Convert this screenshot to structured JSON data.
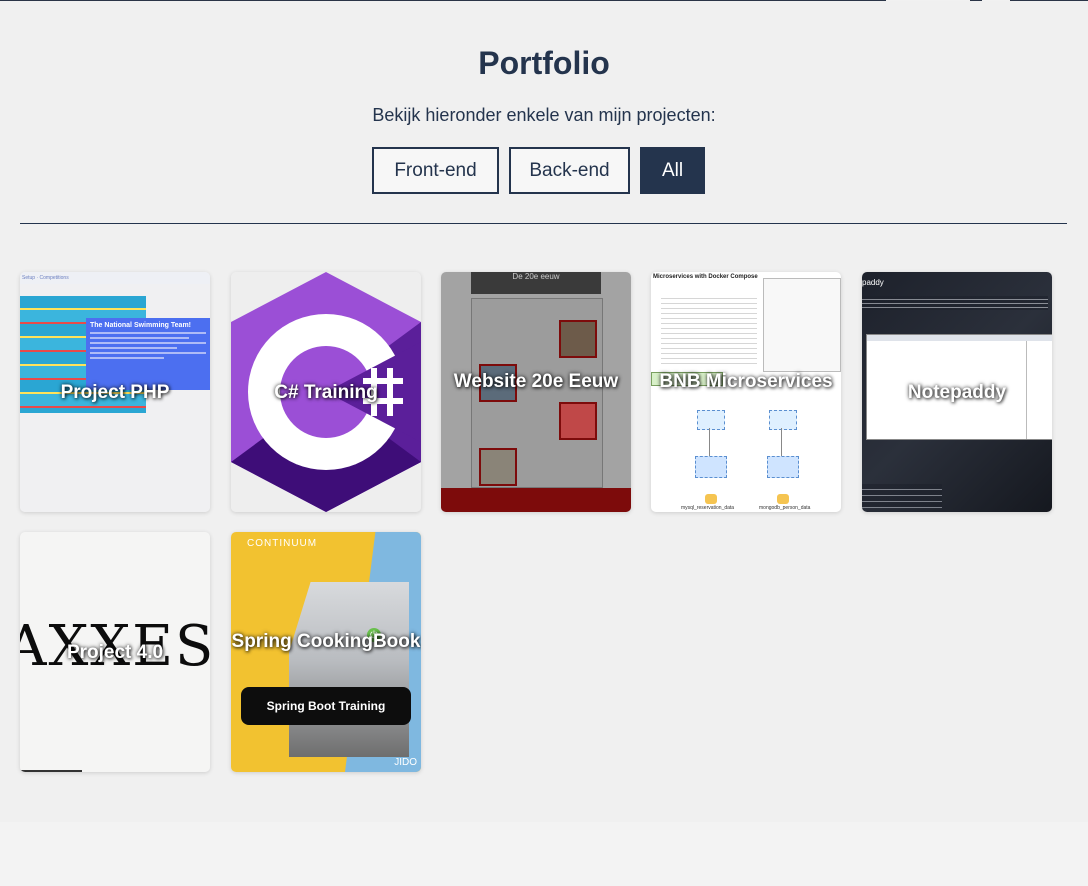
{
  "portfolio": {
    "title": "Portfolio",
    "subtitle": "Bekijk hieronder enkele van mijn projecten:",
    "filters": [
      {
        "label": "Front-end",
        "active": false
      },
      {
        "label": "Back-end",
        "active": false
      },
      {
        "label": "All",
        "active": true
      }
    ],
    "projects": [
      {
        "title": "Project PHP"
      },
      {
        "title": "C# Training"
      },
      {
        "title": "Website 20e Eeuw"
      },
      {
        "title": "BNB Microservices"
      },
      {
        "title": "Notepaddy"
      },
      {
        "title": "Project 4.0"
      },
      {
        "title": "Spring CookingBook"
      }
    ]
  },
  "thumbs": {
    "php": {
      "heading": "The National Swimming Team!"
    },
    "website": {
      "heading": "De 20e eeuw"
    },
    "bnb": {
      "heading": "Microservices with Docker Compose",
      "db1": "mysql_reservation_data",
      "db2": "mongodb_person_data"
    },
    "notepaddy": {
      "heading": "paddy"
    },
    "axxes": {
      "word": "AXXES"
    },
    "spring": {
      "brand": "CONTINUUM",
      "button": "Spring Boot Training",
      "corner": "JIDO"
    }
  },
  "colors": {
    "navy": "#24344d",
    "background": "#f0f0f0"
  }
}
